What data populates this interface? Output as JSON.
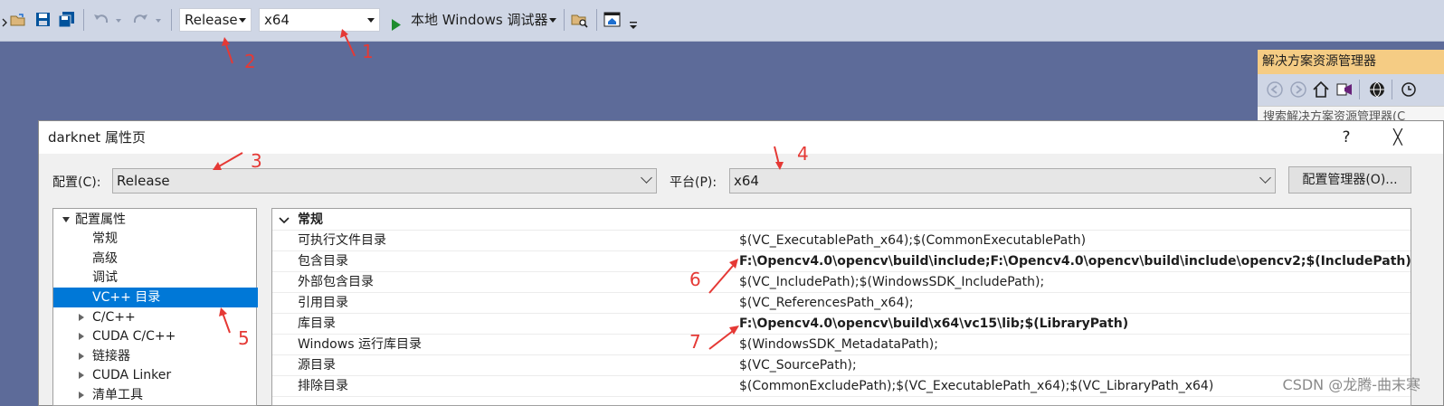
{
  "toolbar": {
    "config_value": "Release",
    "platform_value": "x64",
    "run_label": "本地 Windows 调试器"
  },
  "solution_explorer": {
    "title": "解决方案资源管理器",
    "search_placeholder": "搜索解决方案资源管理器(C"
  },
  "dialog": {
    "title": "darknet 属性页",
    "help": "?",
    "close": "╳",
    "config_label": "配置(C):",
    "config_value": "Release",
    "platform_label": "平台(P):",
    "platform_value": "x64",
    "config_manager_label": "配置管理器(O)..."
  },
  "tree": {
    "root": "配置属性",
    "items": [
      "常规",
      "高级",
      "调试",
      "VC++ 目录",
      "C/C++",
      "CUDA C/C++",
      "链接器",
      "CUDA Linker",
      "清单工具"
    ],
    "selected": "VC++ 目录"
  },
  "grid": {
    "section": "常规",
    "rows": [
      {
        "name": "可执行文件目录",
        "value": "$(VC_ExecutablePath_x64);$(CommonExecutablePath)"
      },
      {
        "name": "包含目录",
        "value": "F:\\Opencv4.0\\opencv\\build\\include;F:\\Opencv4.0\\opencv\\build\\include\\opencv2;$(IncludePath)"
      },
      {
        "name": "外部包含目录",
        "value": "$(VC_IncludePath);$(WindowsSDK_IncludePath);"
      },
      {
        "name": "引用目录",
        "value": "$(VC_ReferencesPath_x64);"
      },
      {
        "name": "库目录",
        "value": "F:\\Opencv4.0\\opencv\\build\\x64\\vc15\\lib;$(LibraryPath)"
      },
      {
        "name": "Windows 运行库目录",
        "value": "$(WindowsSDK_MetadataPath);"
      },
      {
        "name": "源目录",
        "value": "$(VC_SourcePath);"
      },
      {
        "name": "排除目录",
        "value": "$(CommonExcludePath);$(VC_ExecutablePath_x64);$(VC_LibraryPath_x64)"
      }
    ]
  },
  "annotations": [
    "1",
    "2",
    "3",
    "4",
    "5",
    "6",
    "7"
  ],
  "watermark": "CSDN @龙腾-曲末寒",
  "colors": {
    "toolbar": "#cfd6e5",
    "background": "#5d6b99",
    "selection": "#0078d7",
    "annotation": "#e53935",
    "se_title": "#f5cc84"
  }
}
